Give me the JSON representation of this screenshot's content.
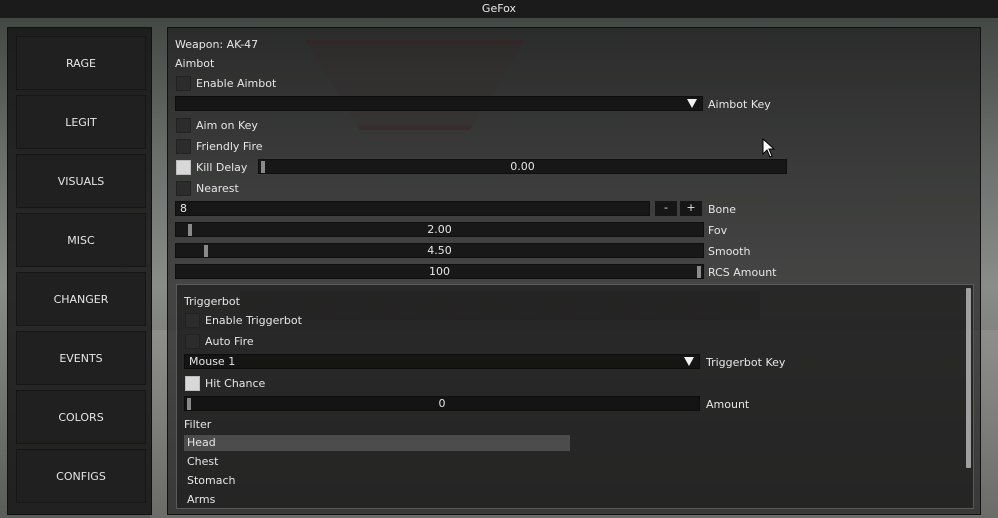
{
  "window": {
    "title": "GeFox"
  },
  "sidebar": {
    "items": [
      {
        "label": "RAGE"
      },
      {
        "label": "LEGIT"
      },
      {
        "label": "VISUALS"
      },
      {
        "label": "MISC"
      },
      {
        "label": "CHANGER"
      },
      {
        "label": "EVENTS"
      },
      {
        "label": "COLORS"
      },
      {
        "label": "CONFIGS"
      }
    ]
  },
  "main": {
    "weapon_label": "Weapon: AK-47",
    "aimbot": {
      "section_title": "Aimbot",
      "enable_label": "Enable Aimbot",
      "enable_checked": false,
      "key_label": "Aimbot Key",
      "key_value": "",
      "aim_on_key_label": "Aim on Key",
      "aim_on_key_checked": false,
      "friendly_fire_label": "Friendly Fire",
      "friendly_fire_checked": false,
      "kill_delay_label": "Kill Delay",
      "kill_delay_checked": true,
      "kill_delay_value": "0.00",
      "nearest_label": "Nearest",
      "nearest_checked": false,
      "bone_label": "Bone",
      "bone_value": "8",
      "bone_minus": "-",
      "bone_plus": "+",
      "fov_label": "Fov",
      "fov_value": "2.00",
      "fov_fraction": 0.02,
      "smooth_label": "Smooth",
      "smooth_value": "4.50",
      "smooth_fraction": 0.05,
      "rcs_label": "RCS Amount",
      "rcs_value": "100",
      "rcs_fraction": 1.0
    },
    "triggerbot": {
      "section_title": "Triggerbot",
      "enable_label": "Enable Triggerbot",
      "enable_checked": false,
      "auto_fire_label": "Auto Fire",
      "auto_fire_checked": false,
      "key_label": "Triggerbot Key",
      "key_value": "Mouse 1",
      "hit_chance_label": "Hit Chance",
      "hit_chance_checked": true,
      "amount_label": "Amount",
      "amount_value": "0",
      "amount_fraction": 0.0,
      "filter_label": "Filter",
      "filter_items": [
        "Head",
        "Chest",
        "Stomach",
        "Arms"
      ],
      "filter_selected": "Head"
    }
  },
  "colors": {
    "panel": "#1a1a1a",
    "field": "#121212",
    "checkbox_on": "#d8d8d8",
    "selected_row": "#4c4c4c",
    "text": "#e6e6e6"
  }
}
